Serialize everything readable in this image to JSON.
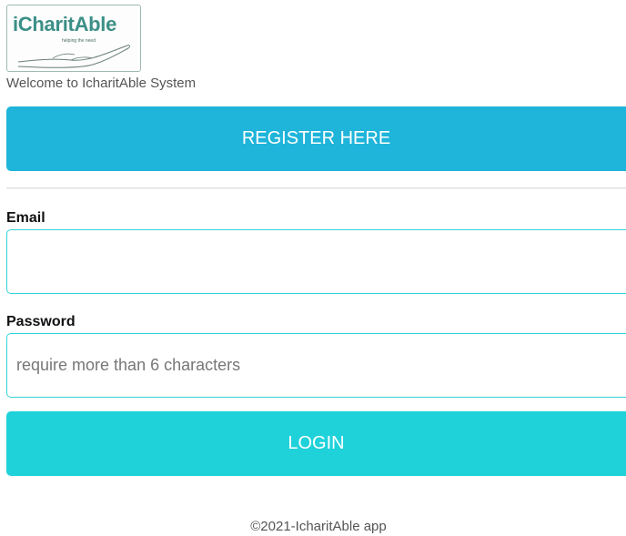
{
  "brand": {
    "logo_text": "iCharitAble",
    "logo_tagline": "helping the need"
  },
  "welcome_text": "Welcome to IcharitAble System",
  "register_button_label": "REGISTER HERE",
  "login_form": {
    "email_label": "Email",
    "email_value": "",
    "password_label": "Password",
    "password_placeholder": "require more than 6 characters",
    "login_button_label": "LOGIN"
  },
  "footer_text": "©2021-IcharitAble app",
  "colors": {
    "register_button": "#1fb4da",
    "login_button": "#1fd2da",
    "input_border": "#33d3d9",
    "logo_text": "#3b8f87"
  },
  "icons": {
    "logo": "open-hand-icon"
  }
}
